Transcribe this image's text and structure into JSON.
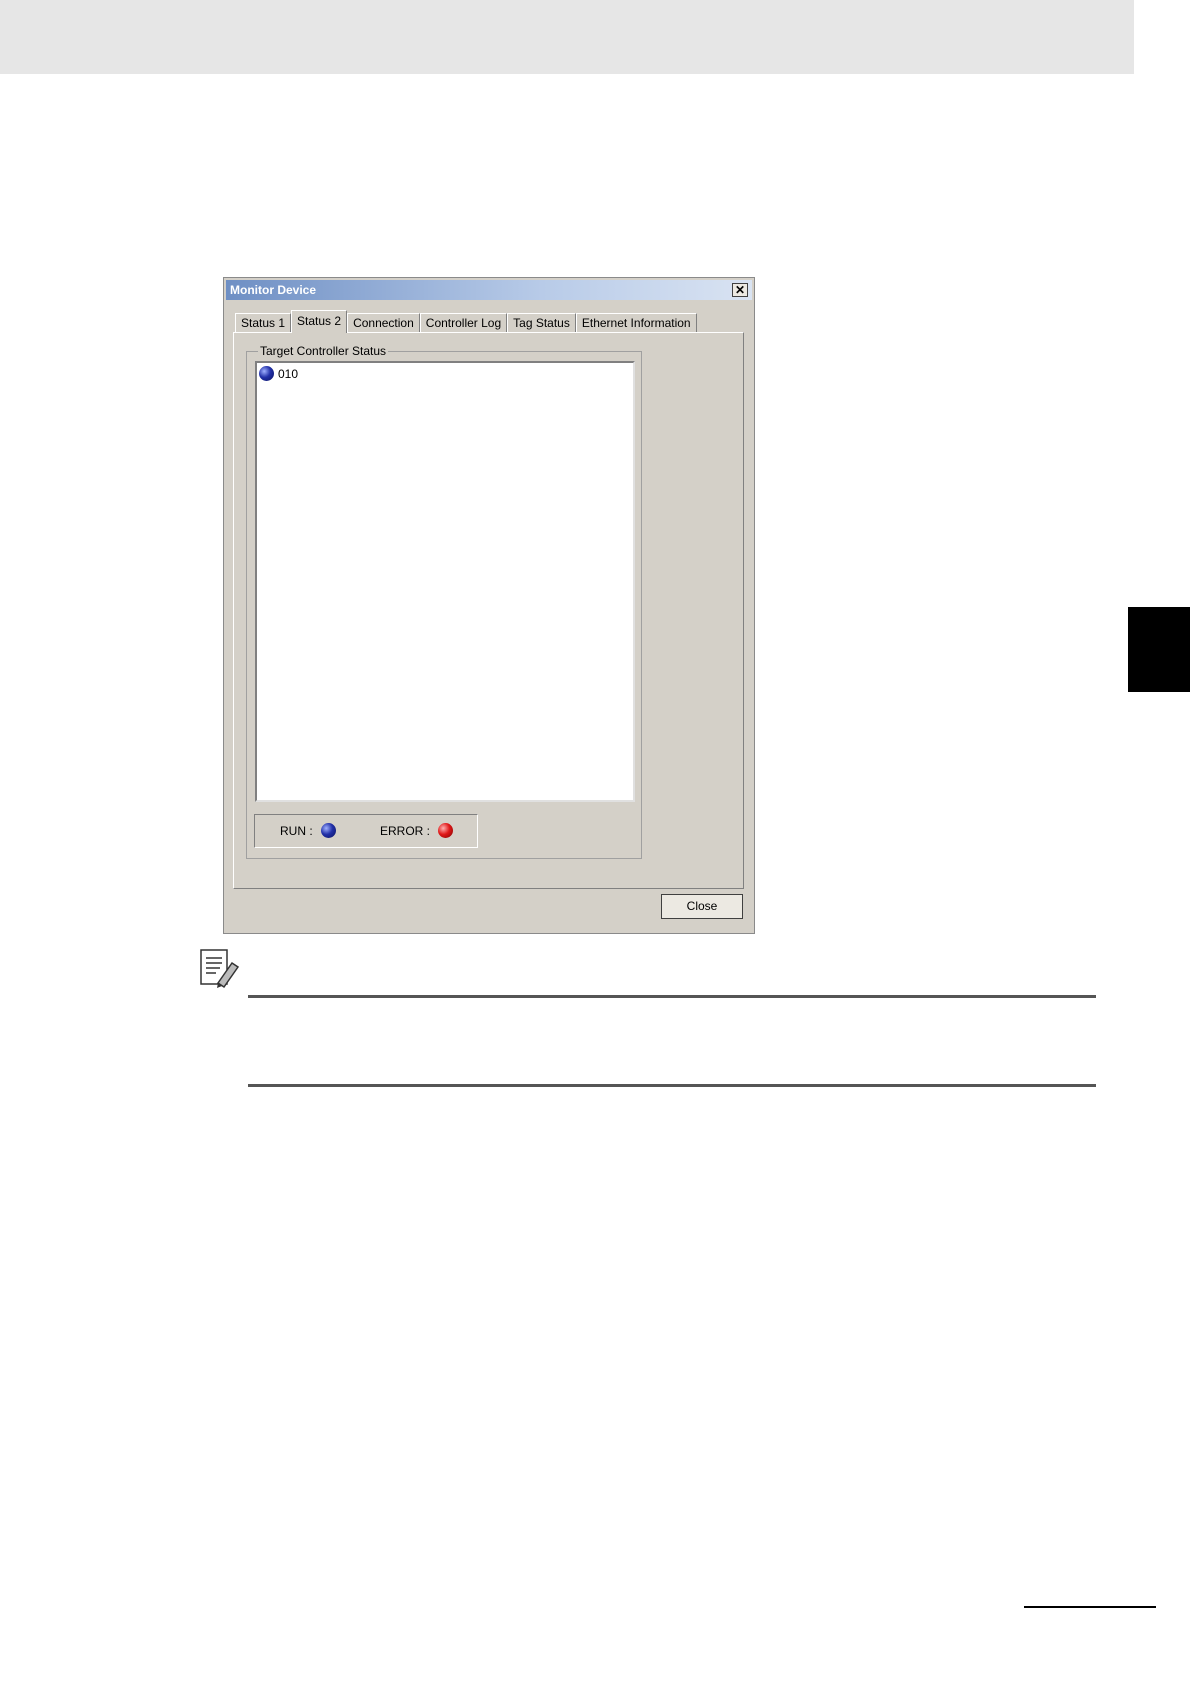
{
  "window": {
    "title": "Monitor Device",
    "close_glyph": "✕",
    "close_button_label": "Close"
  },
  "tabs": [
    {
      "label": "Status 1",
      "active": false
    },
    {
      "label": "Status 2",
      "active": true
    },
    {
      "label": "Connection",
      "active": false
    },
    {
      "label": "Controller Log",
      "active": false
    },
    {
      "label": "Tag Status",
      "active": false
    },
    {
      "label": "Ethernet Information",
      "active": false
    }
  ],
  "target_status": {
    "group_label": "Target Controller Status",
    "items": [
      {
        "label": "010",
        "status": "run"
      }
    ]
  },
  "legend": {
    "run_label": "RUN :",
    "error_label": "ERROR :",
    "run_color": "#2230a8",
    "error_color": "#e01818"
  },
  "icons": {
    "note": "additional-information-icon"
  }
}
